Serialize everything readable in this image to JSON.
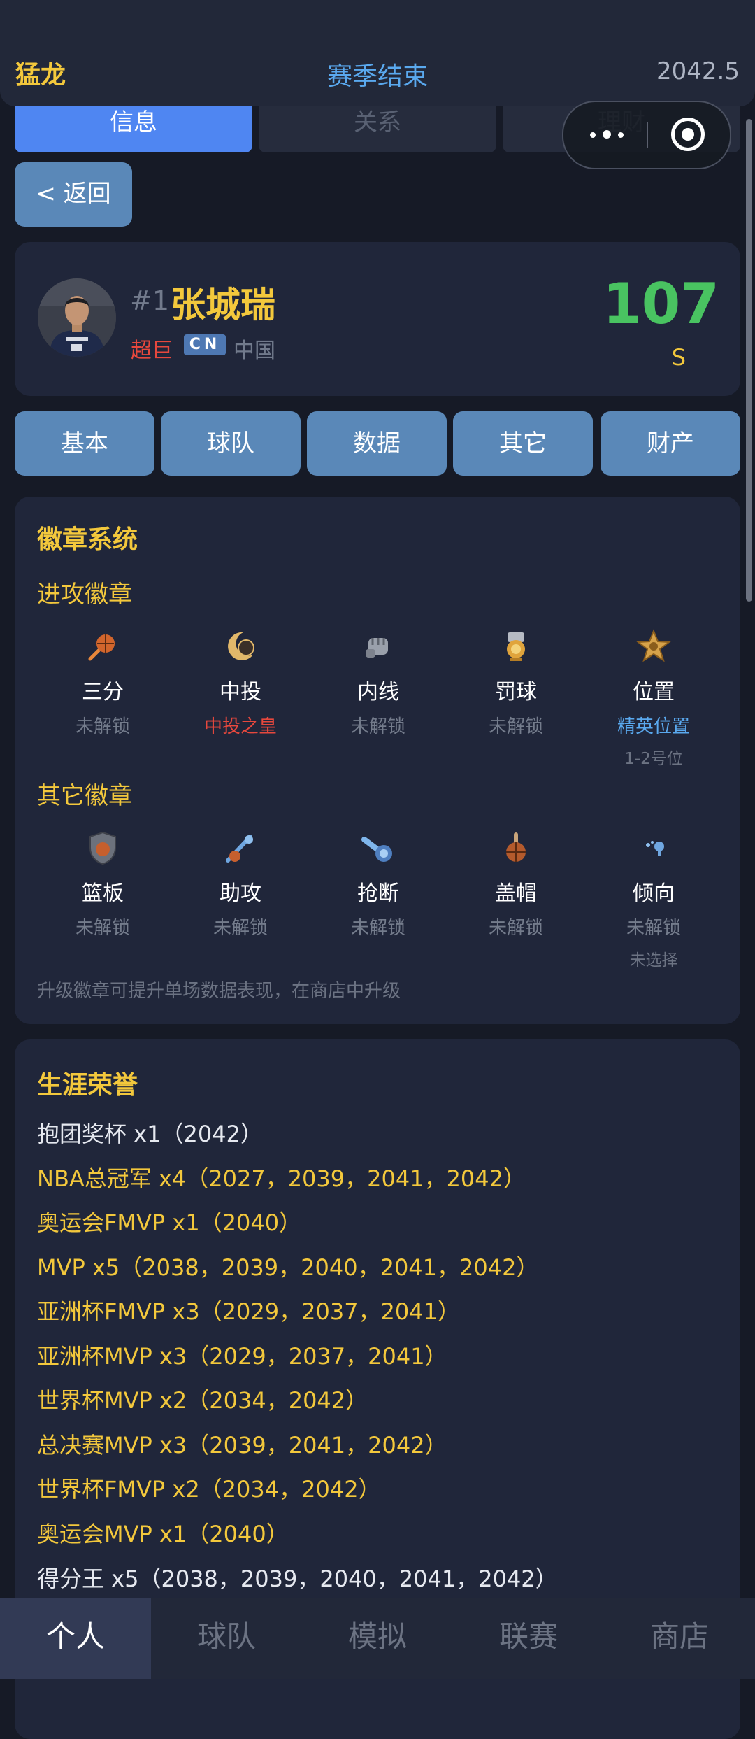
{
  "header": {
    "team": "猛龙",
    "status": "赛季结束",
    "season": "2042.5"
  },
  "tabs": [
    {
      "label": "信息"
    },
    {
      "label": "关系"
    },
    {
      "label": "理财"
    }
  ],
  "back_label": "< 返回",
  "player": {
    "number": "#1",
    "name": "张城瑞",
    "tier": "超巨",
    "country_code": "CN",
    "country": "中国",
    "rating": "107",
    "grade": "S"
  },
  "categories": [
    {
      "label": "基本"
    },
    {
      "label": "球队"
    },
    {
      "label": "数据"
    },
    {
      "label": "其它"
    },
    {
      "label": "财产"
    }
  ],
  "badges": {
    "title": "徽章系统",
    "offense_title": "进攻徽章",
    "offense": [
      {
        "name": "三分",
        "status": "未解锁",
        "icon": "fireball-icon"
      },
      {
        "name": "中投",
        "status": "中投之皇",
        "icon": "crescent-ball-icon"
      },
      {
        "name": "内线",
        "status": "未解锁",
        "icon": "fist-icon"
      },
      {
        "name": "罚球",
        "status": "未解锁",
        "icon": "trophy-icon"
      },
      {
        "name": "位置",
        "status": "精英位置",
        "extra": "1-2号位",
        "icon": "star-medal-icon"
      }
    ],
    "other_title": "其它徽章",
    "other": [
      {
        "name": "篮板",
        "status": "未解锁",
        "icon": "shield-icon"
      },
      {
        "name": "助攻",
        "status": "未解锁",
        "icon": "pass-icon"
      },
      {
        "name": "抢断",
        "status": "未解锁",
        "icon": "steal-icon"
      },
      {
        "name": "盖帽",
        "status": "未解锁",
        "icon": "block-icon"
      },
      {
        "name": "倾向",
        "status": "未解锁",
        "extra": "未选择",
        "icon": "tendency-icon"
      }
    ],
    "note": "升级徽章可提升单场数据表现，在商店中升级"
  },
  "honors": {
    "title": "生涯荣誉",
    "items": [
      "抱团奖杯 x1（2042）",
      "NBA总冠军 x4（2027，2039，2041，2042）",
      "奥运会FMVP x1（2040）",
      "MVP x5（2038，2039，2040，2041，2042）",
      "亚洲杯FMVP x3（2029，2037，2041）",
      "亚洲杯MVP x3（2029，2037，2041）",
      "世界杯MVP x2（2034，2042）",
      "总决赛MVP x3（2039，2041，2042）",
      "世界杯FMVP x2（2034，2042）",
      "奥运会MVP x1（2040）",
      "得分王 x5（2038，2039，2040，2041，2042）"
    ]
  },
  "bottom_nav": [
    {
      "label": "个人"
    },
    {
      "label": "球队"
    },
    {
      "label": "模拟"
    },
    {
      "label": "联赛"
    },
    {
      "label": "商店"
    }
  ]
}
